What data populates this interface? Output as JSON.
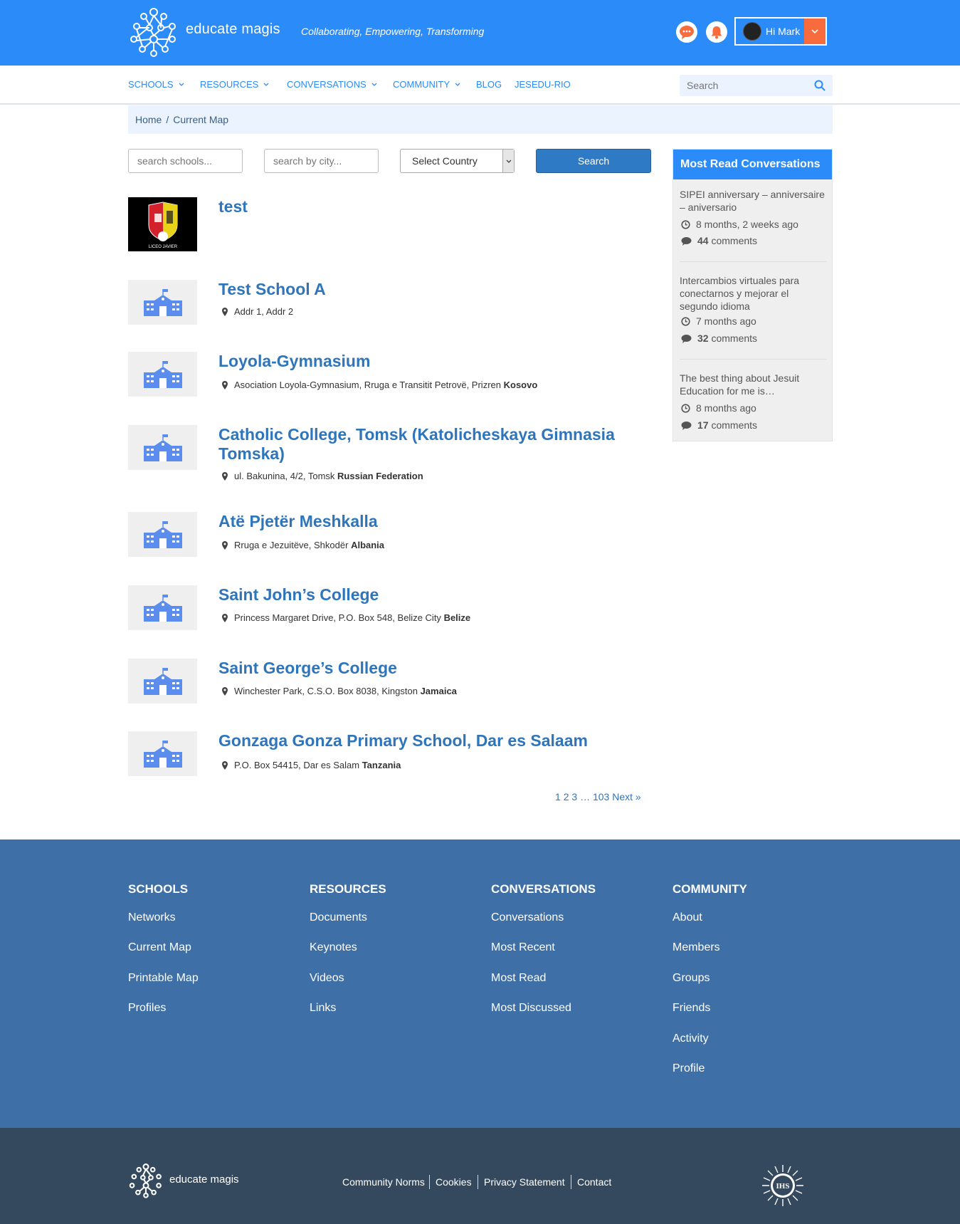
{
  "header": {
    "brand": "educate magis",
    "tagline": "Collaborating, Empowering, Transforming",
    "user_greeting": "Hi Mark",
    "icons": [
      "chat-icon",
      "bell-icon",
      "chevron-down-icon"
    ],
    "accent": "#2b8bf9",
    "notification_color": "#f76b3d"
  },
  "nav": {
    "items": [
      "SCHOOLS",
      "RESOURCES",
      "CONVERSATIONS",
      "COMMUNITY",
      "BLOG",
      "JESEDU-RIO"
    ],
    "search_placeholder": "Search"
  },
  "breadcrumb": {
    "home": "Home",
    "separator": "/",
    "current": "Current Map"
  },
  "filters": {
    "school_placeholder": "search schools...",
    "city_placeholder": "search by city...",
    "country_select": "Select Country",
    "search_button": "Search"
  },
  "schools": [
    {
      "name": "test",
      "address": "",
      "country": "",
      "thumb": "liceo-javier-logo",
      "thumb_caption": "LICEO JAVIER"
    },
    {
      "name": "Test School A",
      "address": "Addr 1, Addr 2",
      "country": ""
    },
    {
      "name": "Loyola-Gymnasium",
      "address": "Asociation Loyola-Gymnasium, Rruga e Transitit Petrovë, Prizren",
      "country": "Kosovo"
    },
    {
      "name": "Catholic College, Tomsk (Katolicheskaya Gimnasia Tomska)",
      "address": "ul. Bakunina, 4/2, Tomsk",
      "country": "Russian Federation"
    },
    {
      "name": "Atë Pjetër Meshkalla",
      "address": "Rruga e Jezuitëve, Shkodër",
      "country": "Albania"
    },
    {
      "name": "Saint John’s College",
      "address": "Princess Margaret Drive, P.O. Box 548, Belize City",
      "country": "Belize"
    },
    {
      "name": "Saint George’s College",
      "address": "Winchester Park, C.S.O. Box 8038, Kingston",
      "country": "Jamaica"
    },
    {
      "name": "Gonzaga Gonza Primary School, Dar es Salaam",
      "address": "P.O. Box 54415, Dar es Salam",
      "country": "Tanzania"
    }
  ],
  "pagination": {
    "pages": [
      "1",
      "2",
      "3"
    ],
    "ellipsis": "…",
    "last": "103",
    "next": "Next »"
  },
  "sidebar": {
    "title": "Most Read Conversations",
    "items": [
      {
        "title": "SIPEI anniversary – anniversaire – aniversario",
        "time": "8 months, 2 weeks ago",
        "count": "44",
        "comments_label": "comments"
      },
      {
        "title": "Intercambios virtuales para conectarnos y mejorar el segundo idioma",
        "time": "7 months ago",
        "count": "32",
        "comments_label": "comments"
      },
      {
        "title": "The best thing about Jesuit Education for me is…",
        "time": "8 months ago",
        "count": "17",
        "comments_label": "comments"
      }
    ]
  },
  "footer": {
    "columns": [
      {
        "heading": "SCHOOLS",
        "links": [
          "Networks",
          "Current Map",
          "Printable Map",
          "Profiles"
        ]
      },
      {
        "heading": "RESOURCES",
        "links": [
          "Documents",
          "Keynotes",
          "Videos",
          "Links"
        ]
      },
      {
        "heading": "CONVERSATIONS",
        "links": [
          "Conversations",
          "Most Recent",
          "Most Read",
          "Most Discussed"
        ]
      },
      {
        "heading": "COMMUNITY",
        "links": [
          "About",
          "Members",
          "Groups",
          "Friends",
          "Activity",
          "Profile"
        ]
      }
    ],
    "bottom_brand": "educate magis",
    "bottom_links": [
      "Community Norms",
      "Cookies",
      "Privacy Statement",
      "Contact"
    ],
    "seal_text": "IHS"
  }
}
